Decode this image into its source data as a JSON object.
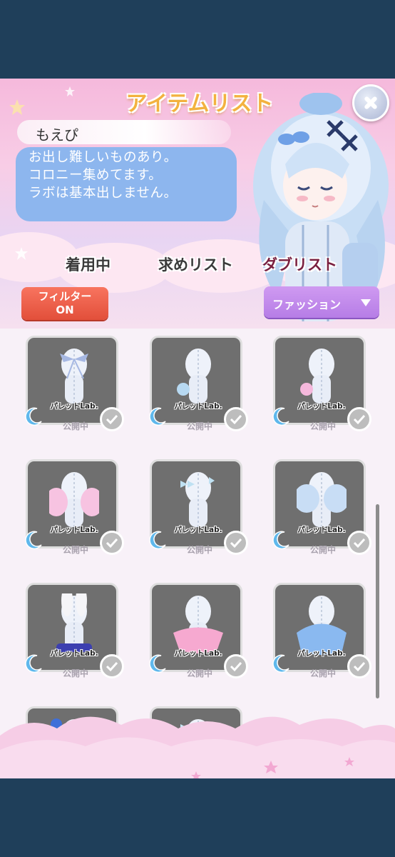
{
  "header": {
    "title": "アイテムリスト",
    "user_name": "もえぴ",
    "message": "お出し難しいものあり。\nコロニー集めてます。\nラボは基本出しません。"
  },
  "tabs": [
    {
      "label": "着用中",
      "active": false
    },
    {
      "label": "求めリスト",
      "active": false
    },
    {
      "label": "ダブリスト",
      "active": true
    }
  ],
  "filter_button": {
    "label_line1": "フィルター",
    "label_line2": "ON"
  },
  "category_select": {
    "value": "ファッション"
  },
  "items": [
    {
      "brand": "パレットLab.",
      "status": "公開中",
      "style": "bow-ribbon"
    },
    {
      "brand": "パレットLab.",
      "status": "公開中",
      "style": "blue-flower"
    },
    {
      "brand": "パレットLab.",
      "status": "公開中",
      "style": "pink-flower"
    },
    {
      "brand": "パレットLab.",
      "status": "公開中",
      "style": "pink-puff"
    },
    {
      "brand": "パレットLab.",
      "status": "公開中",
      "style": "blue-bows"
    },
    {
      "brand": "パレットLab.",
      "status": "公開中",
      "style": "blue-puff"
    },
    {
      "brand": "パレットLab.",
      "status": "公開中",
      "style": "bunny-ears"
    },
    {
      "brand": "パレットLab.",
      "status": "公開中",
      "style": "pink-skirt"
    },
    {
      "brand": "パレットLab.",
      "status": "公開中",
      "style": "blue-dress"
    },
    {
      "brand": "",
      "status": "",
      "style": "blue-roses"
    },
    {
      "brand": "",
      "status": "",
      "style": "blue-bows-2"
    }
  ],
  "colors": {
    "background": "#1f3f5a",
    "speech_bubble": "#8db6ee",
    "filter_button": "#e9553f",
    "select_button": "#c28cee",
    "title": "#f3b23f",
    "active_tab": "#7a2040"
  }
}
